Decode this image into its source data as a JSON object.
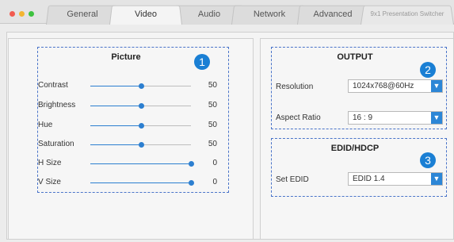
{
  "tabs": [
    {
      "label": "General",
      "active": false
    },
    {
      "label": "Video",
      "active": true
    },
    {
      "label": "Audio",
      "active": false
    },
    {
      "label": "Network",
      "active": false
    },
    {
      "label": "Advanced",
      "active": false
    }
  ],
  "app_title": "9x1 Presentation Switcher",
  "picture": {
    "title": "Picture",
    "badge": "1",
    "sliders": [
      {
        "label": "Contrast",
        "value": "50",
        "level": 0.5
      },
      {
        "label": "Brightness",
        "value": "50",
        "level": 0.5
      },
      {
        "label": "Hue",
        "value": "50",
        "level": 0.5
      },
      {
        "label": "Saturation",
        "value": "50",
        "level": 0.5
      },
      {
        "label": "H Size",
        "value": "0",
        "level": 1.0
      },
      {
        "label": "V Size",
        "value": "0",
        "level": 1.0
      }
    ]
  },
  "output": {
    "title": "OUTPUT",
    "badge": "2",
    "resolution_label": "Resolution",
    "resolution_value": "1024x768@60Hz",
    "aspect_label": "Aspect Ratio",
    "aspect_value": "16 : 9"
  },
  "edid": {
    "title": "EDID/HDCP",
    "badge": "3",
    "set_label": "Set EDID",
    "set_value": "EDID 1.4"
  },
  "colors": {
    "accent": "#2c7fd0",
    "badge": "#1a7fd4",
    "dash_border": "#4a74c9"
  }
}
